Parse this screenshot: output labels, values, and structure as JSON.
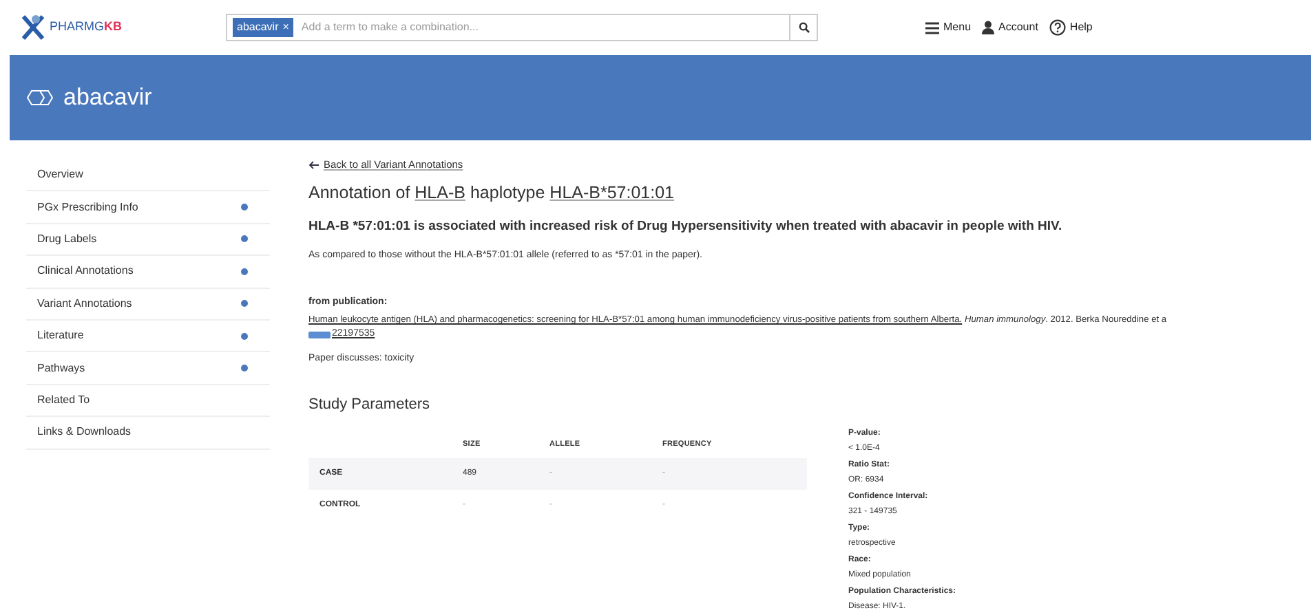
{
  "header": {
    "logo": {
      "prefix": "PHARMG",
      "suffix": "KB"
    },
    "search": {
      "tag": "abacavir",
      "tag_close": "×",
      "placeholder": "Add a term to make a combination..."
    },
    "nav": [
      {
        "kind": "menu",
        "label": "Menu"
      },
      {
        "kind": "account",
        "label": "Account"
      },
      {
        "kind": "help",
        "label": "Help"
      }
    ]
  },
  "banner": {
    "title": "abacavir"
  },
  "sidebar": {
    "items": [
      {
        "label": "Overview",
        "dot": false
      },
      {
        "label": "PGx Prescribing Info",
        "dot": true
      },
      {
        "label": "Drug Labels",
        "dot": true
      },
      {
        "label": "Clinical Annotations",
        "dot": true
      },
      {
        "label": "Variant Annotations",
        "dot": true
      },
      {
        "label": "Literature",
        "dot": true
      },
      {
        "label": "Pathways",
        "dot": true
      },
      {
        "label": "Related To",
        "dot": false
      },
      {
        "label": "Links & Downloads",
        "dot": false
      }
    ]
  },
  "content": {
    "back_link": "Back to all Variant Annotations",
    "title": {
      "prefix": "Annotation of",
      "gene": "HLA-B",
      "middle": "haplotype",
      "haplotype": "HLA-B*57:01:01"
    },
    "summary": "HLA-B *57:01:01 is associated with increased risk of Drug Hypersensitivity when treated with abacavir in people with HIV.",
    "note": "As compared to those without the HLA-B*57:01:01 allele (referred to as *57:01 in the paper).",
    "publication": {
      "heading": "from publication:",
      "title": "Human leukocyte antigen (HLA) and pharmacogenetics: screening for HLA-B*57:01 among human immunodeficiency virus-positive patients from southern Alberta.",
      "citation": "*Human immunology*. 2012. Berka Noureddine et a",
      "pubmed_id": "22197535"
    },
    "discusses": "Paper discusses: toxicity",
    "study": {
      "heading": "Study Parameters",
      "columns": [
        "SIZE",
        "ALLELE",
        "FREQUENCY"
      ],
      "rows": [
        {
          "label": "CASE",
          "cells": [
            "489",
            "-",
            "-"
          ]
        },
        {
          "label": "CONTROL",
          "cells": [
            "-",
            "-",
            "-"
          ]
        }
      ],
      "details": [
        {
          "label": "P-value:",
          "value": "< 1.0E-4"
        },
        {
          "label": "Ratio Stat:",
          "value": "OR: 6934"
        },
        {
          "label": "Confidence Interval:",
          "value": "321 - 149735"
        },
        {
          "label": "Type:",
          "value": "retrospective"
        },
        {
          "label": "Race:",
          "value": "Mixed population"
        },
        {
          "label": "Population Characteristics:",
          "value": "Disease: HIV-1."
        }
      ]
    }
  }
}
